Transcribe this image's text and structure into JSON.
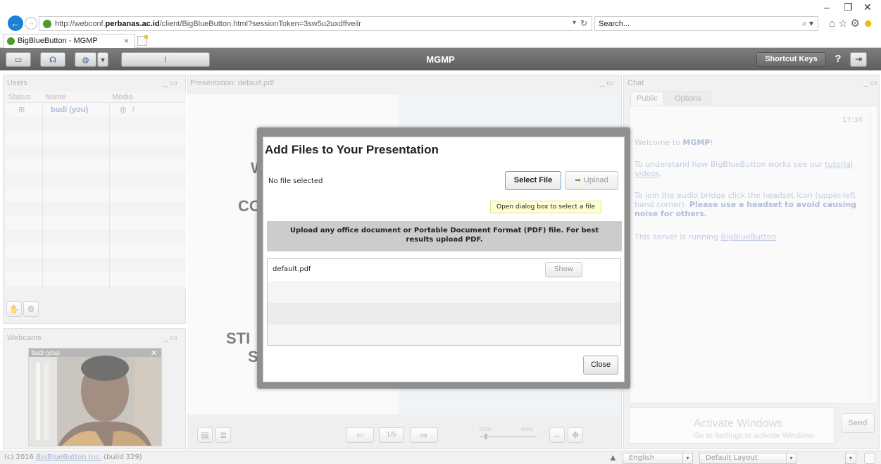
{
  "browser": {
    "url_prefix": "http://webconf.",
    "url_domain": "perbanas.ac.id",
    "url_suffix": "/client/BigBlueButton.html?sessionToken=3sw5u2uxdffveilr",
    "search_placeholder": "Search...",
    "tab_title": "BigBlueButton - MGMP",
    "icons": [
      "back-icon",
      "forward-icon",
      "refresh-icon",
      "search-icon",
      "home-icon",
      "star-icon",
      "gear-icon",
      "smiley-icon"
    ]
  },
  "toolbar": {
    "title": "MGMP",
    "shortcut_keys": "Shortcut Keys",
    "help": "?"
  },
  "users": {
    "title": "Users",
    "columns": [
      "Status",
      "Name",
      "Media"
    ],
    "rows": [
      {
        "name": "budi (you)"
      }
    ]
  },
  "webcams": {
    "title": "Webcams",
    "label": "budi (you)"
  },
  "presentation": {
    "title": "Presentation: default.pdf",
    "slide_fragments": [
      "W",
      "CO",
      "STI",
      "S"
    ],
    "page": "1/5",
    "zoom_min": "100%",
    "zoom_max": "400%"
  },
  "chat": {
    "title": "Chat",
    "tabs": [
      "Public",
      "Options"
    ],
    "time": "17:34",
    "welcome_prefix": "Welcome to ",
    "welcome_room": "MGMP",
    "welcome_suffix": "!",
    "tutorial_prefix": "To understand how BigBlueButton works see our ",
    "tutorial_link": "tutorial videos",
    "tutorial_suffix": ".",
    "audio_prefix": "To join the audio bridge click the headset icon (upper-left hand corner). ",
    "audio_bold": "Please use a headset to avoid causing noise for others.",
    "server_prefix": "This server is running ",
    "server_link": "BigBlueButton",
    "server_suffix": ".",
    "send": "Send",
    "activate_title": "Activate Windows",
    "activate_sub": "Go to Settings to activate Windows."
  },
  "footer": {
    "copyright_prefix": "(c) 2016 ",
    "copyright_link": "BigBlueButton Inc.",
    "copyright_suffix": " (build 329)",
    "language": "English",
    "layout": "Default Layout"
  },
  "dialog": {
    "title": "Add Files to Your Presentation",
    "no_file": "No file selected",
    "select_file": "Select File",
    "upload": "Upload",
    "tooltip": "Open dialog box to select a file",
    "info": "Upload any office document or Portable Document Format (PDF) file.  For best results upload PDF.",
    "files": [
      {
        "name": "default.pdf",
        "action": "Show"
      }
    ],
    "close": "Close"
  }
}
